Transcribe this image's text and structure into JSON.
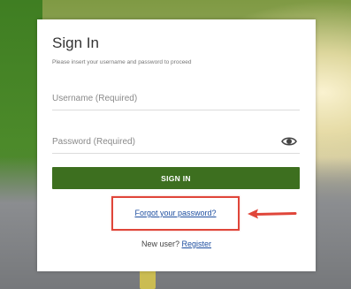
{
  "signin": {
    "title": "Sign In",
    "subtitle": "Please insert your username and password to proceed",
    "username_placeholder": "Username (Required)",
    "password_placeholder": "Password (Required)",
    "signin_button": "SIGN IN",
    "forgot_link": "Forgot your password?",
    "new_user_text": "New user?",
    "register_link": "Register"
  },
  "icons": {
    "show_password": "eye-icon",
    "annotation_arrow": "arrow-left-icon"
  },
  "colors": {
    "primary_button": "#3d6f1f",
    "link": "#1f4fa0",
    "annotation": "#e0463a"
  }
}
